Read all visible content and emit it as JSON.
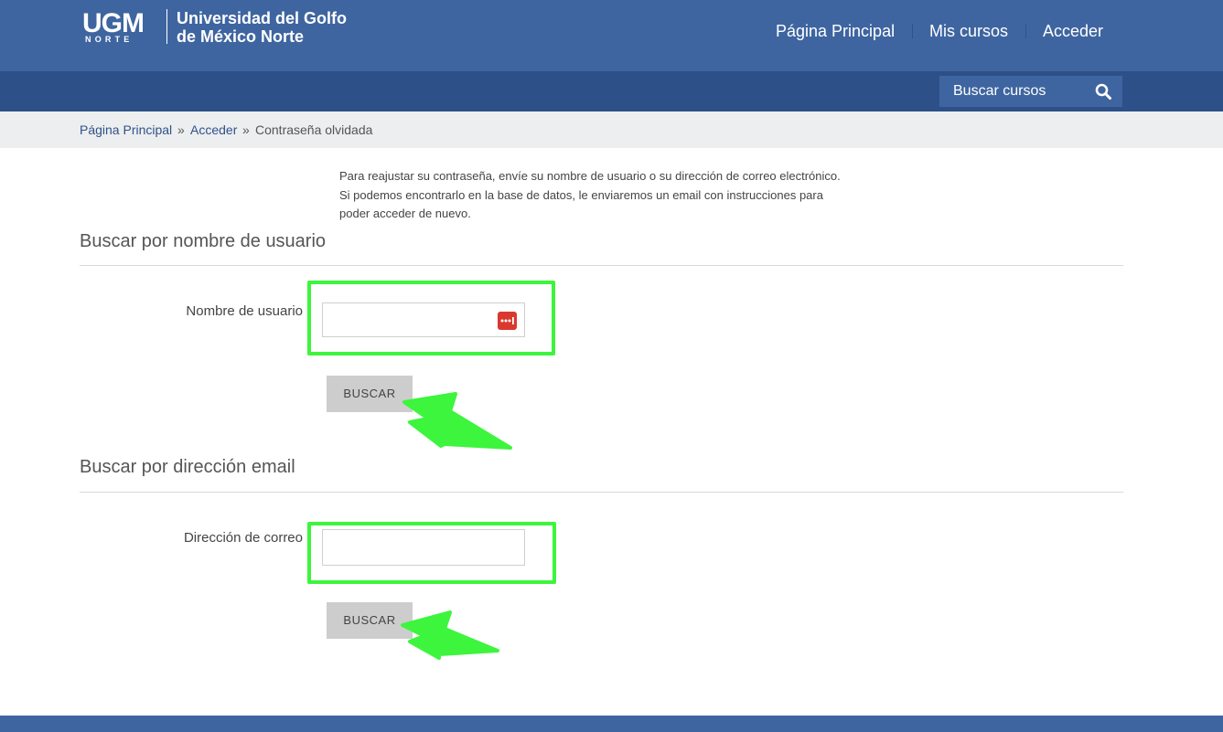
{
  "header": {
    "logo_text": "UGM NORTE",
    "brand_line1": "Universidad del Golfo",
    "brand_line2": "de México Norte",
    "nav": [
      "Página Principal",
      "Mis cursos",
      "Acceder"
    ]
  },
  "search": {
    "label": "Buscar cursos",
    "icon": "search-icon"
  },
  "breadcrumb": {
    "items": [
      "Página Principal",
      "Acceder",
      "Contraseña olvidada"
    ],
    "separator": "»"
  },
  "intro": "Para reajustar su contraseña, envíe su nombre de usuario o su dirección de correo electrónico. Si podemos encontrarlo en la base de datos, le enviaremos un email con instrucciones para poder acceder de nuevo.",
  "username_section": {
    "title": "Buscar por nombre de usuario",
    "label": "Nombre de usuario",
    "value": "",
    "button": "BUSCAR"
  },
  "email_section": {
    "title": "Buscar por dirección email",
    "label": "Dirección de correo",
    "value": "",
    "button": "BUSCAR"
  },
  "colors": {
    "header": "#3e65a0",
    "subheader": "#2d5089",
    "highlight": "#3cf53c",
    "password_manager_icon": "#d9382f"
  }
}
